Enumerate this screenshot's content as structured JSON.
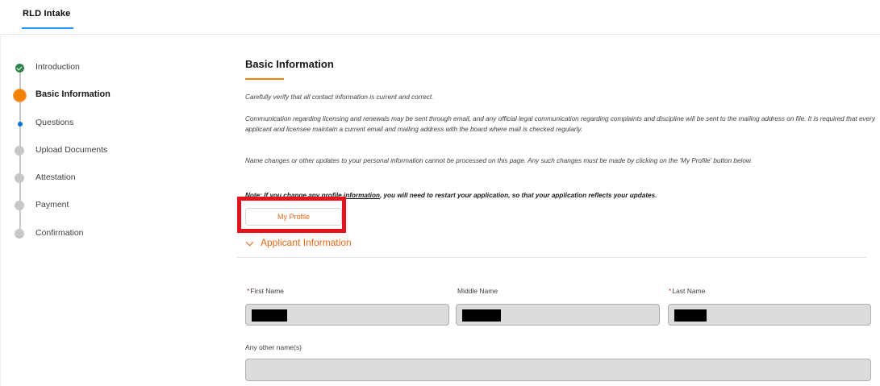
{
  "header": {
    "tab_label": "RLD Intake"
  },
  "steps": [
    {
      "label": "Introduction",
      "state": "complete"
    },
    {
      "label": "Basic Information",
      "state": "current"
    },
    {
      "label": "Questions",
      "state": "next"
    },
    {
      "label": "Upload Documents",
      "state": "todo"
    },
    {
      "label": "Attestation",
      "state": "todo"
    },
    {
      "label": "Payment",
      "state": "todo"
    },
    {
      "label": "Confirmation",
      "state": "todo"
    }
  ],
  "main": {
    "title": "Basic Information",
    "para1": "Carefully verify that all contact information is current and correct.",
    "para2": "Communication regarding licensing and renewals may be sent through email, and any official legal communication regarding complaints and discipline will be sent to the mailing address on file. It is required that every applicant and licensee maintain a current email and mailing address with the board where mail is checked regularly.",
    "para3": "Name changes or other updates to your personal information cannot be processed on this page. Any such changes must be made by clicking on the 'My Profile' button below.",
    "note_underlined": "Note: If you change any profile information",
    "note_rest": ", you will need to restart your application, so that your application reflects your updates.",
    "profile_button": "My Profile",
    "accordion_label": "Applicant Information"
  },
  "form": {
    "first_name_label": "First Name",
    "middle_name_label": "Middle Name",
    "last_name_label": "Last Name",
    "other_names_label": "Any other name(s)",
    "required_mark": "*"
  },
  "colors": {
    "accent_orange": "#f38303",
    "link_orange": "#e56717",
    "complete_green": "#2e844a",
    "next_blue": "#0176d3",
    "highlight_red": "#e3141d"
  }
}
